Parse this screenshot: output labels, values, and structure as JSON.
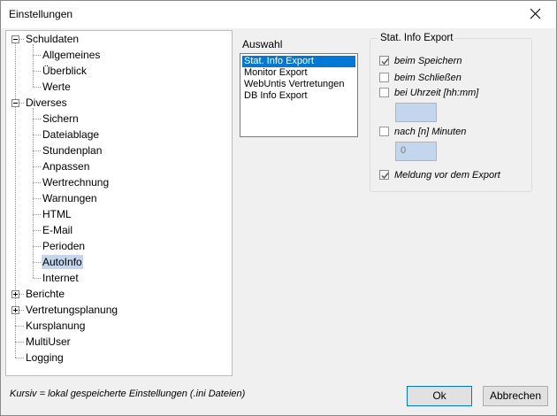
{
  "window": {
    "title": "Einstellungen"
  },
  "tree": {
    "items": [
      {
        "label": "Schuldaten",
        "level": 0,
        "expander": "minus"
      },
      {
        "label": "Allgemeines",
        "level": 1
      },
      {
        "label": "Überblick",
        "level": 1
      },
      {
        "label": "Werte",
        "level": 1
      },
      {
        "label": "Diverses",
        "level": 0,
        "expander": "minus"
      },
      {
        "label": "Sichern",
        "level": 1
      },
      {
        "label": "Dateiablage",
        "level": 1
      },
      {
        "label": "Stundenplan",
        "level": 1
      },
      {
        "label": "Anpassen",
        "level": 1
      },
      {
        "label": "Wertrechnung",
        "level": 1
      },
      {
        "label": "Warnungen",
        "level": 1
      },
      {
        "label": "HTML",
        "level": 1
      },
      {
        "label": "E-Mail",
        "level": 1
      },
      {
        "label": "Perioden",
        "level": 1
      },
      {
        "label": "AutoInfo",
        "level": 1,
        "selected": true
      },
      {
        "label": "Internet",
        "level": 1
      },
      {
        "label": "Berichte",
        "level": 0,
        "expander": "plus"
      },
      {
        "label": "Vertretungsplanung",
        "level": 0,
        "expander": "plus"
      },
      {
        "label": "Kursplanung",
        "level": 0
      },
      {
        "label": "MultiUser",
        "level": 0
      },
      {
        "label": "Logging",
        "level": 0
      }
    ]
  },
  "auswahl": {
    "label": "Auswahl",
    "items": [
      "Stat. Info Export",
      "Monitor Export",
      "WebUntis Vertretungen",
      "DB Info Export"
    ],
    "selected_index": 0
  },
  "export_group": {
    "title": "Stat. Info Export",
    "options": {
      "beim_speichern": {
        "label": "beim Speichern",
        "checked": true
      },
      "beim_schliessen": {
        "label": "beim Schließen",
        "checked": false
      },
      "bei_uhrzeit": {
        "label": "bei Uhrzeit [hh:mm]",
        "checked": false
      },
      "nach_minuten": {
        "label": "nach [n] Minuten",
        "checked": false
      },
      "meldung": {
        "label": "Meldung vor dem Export",
        "checked": true
      }
    },
    "uhrzeit_value": "",
    "minuten_value": "0"
  },
  "footer": {
    "note": "Kursiv = lokal gespeicherte Einstellungen (.ini Dateien)",
    "ok_label": "Ok",
    "cancel_label": "Abbrechen"
  }
}
